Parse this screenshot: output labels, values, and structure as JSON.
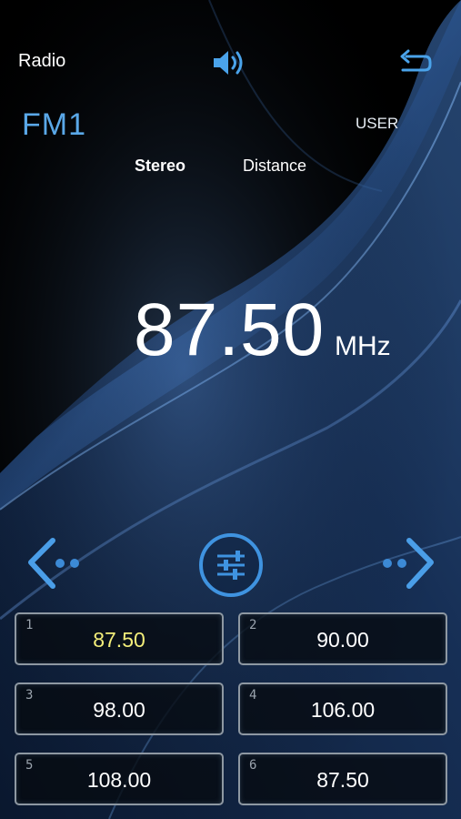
{
  "header": {
    "title": "Radio"
  },
  "status": {
    "band": "FM1",
    "mode": "USER",
    "stereo_label": "Stereo",
    "distance_label": "Distance"
  },
  "tuner": {
    "frequency": "87.50",
    "unit": "MHz"
  },
  "icons": {
    "volume": "speaker-icon",
    "back": "return-arrow-icon",
    "prev": "seek-previous-icon",
    "eq": "equalizer-sliders-icon",
    "next": "seek-next-icon"
  },
  "colors": {
    "accent": "#5aa8e8",
    "active_preset": "#f3ee7a"
  },
  "presets": [
    {
      "num": "1",
      "value": "87.50",
      "active": true
    },
    {
      "num": "2",
      "value": "90.00",
      "active": false
    },
    {
      "num": "3",
      "value": "98.00",
      "active": false
    },
    {
      "num": "4",
      "value": "106.00",
      "active": false
    },
    {
      "num": "5",
      "value": "108.00",
      "active": false
    },
    {
      "num": "6",
      "value": "87.50",
      "active": false
    }
  ]
}
